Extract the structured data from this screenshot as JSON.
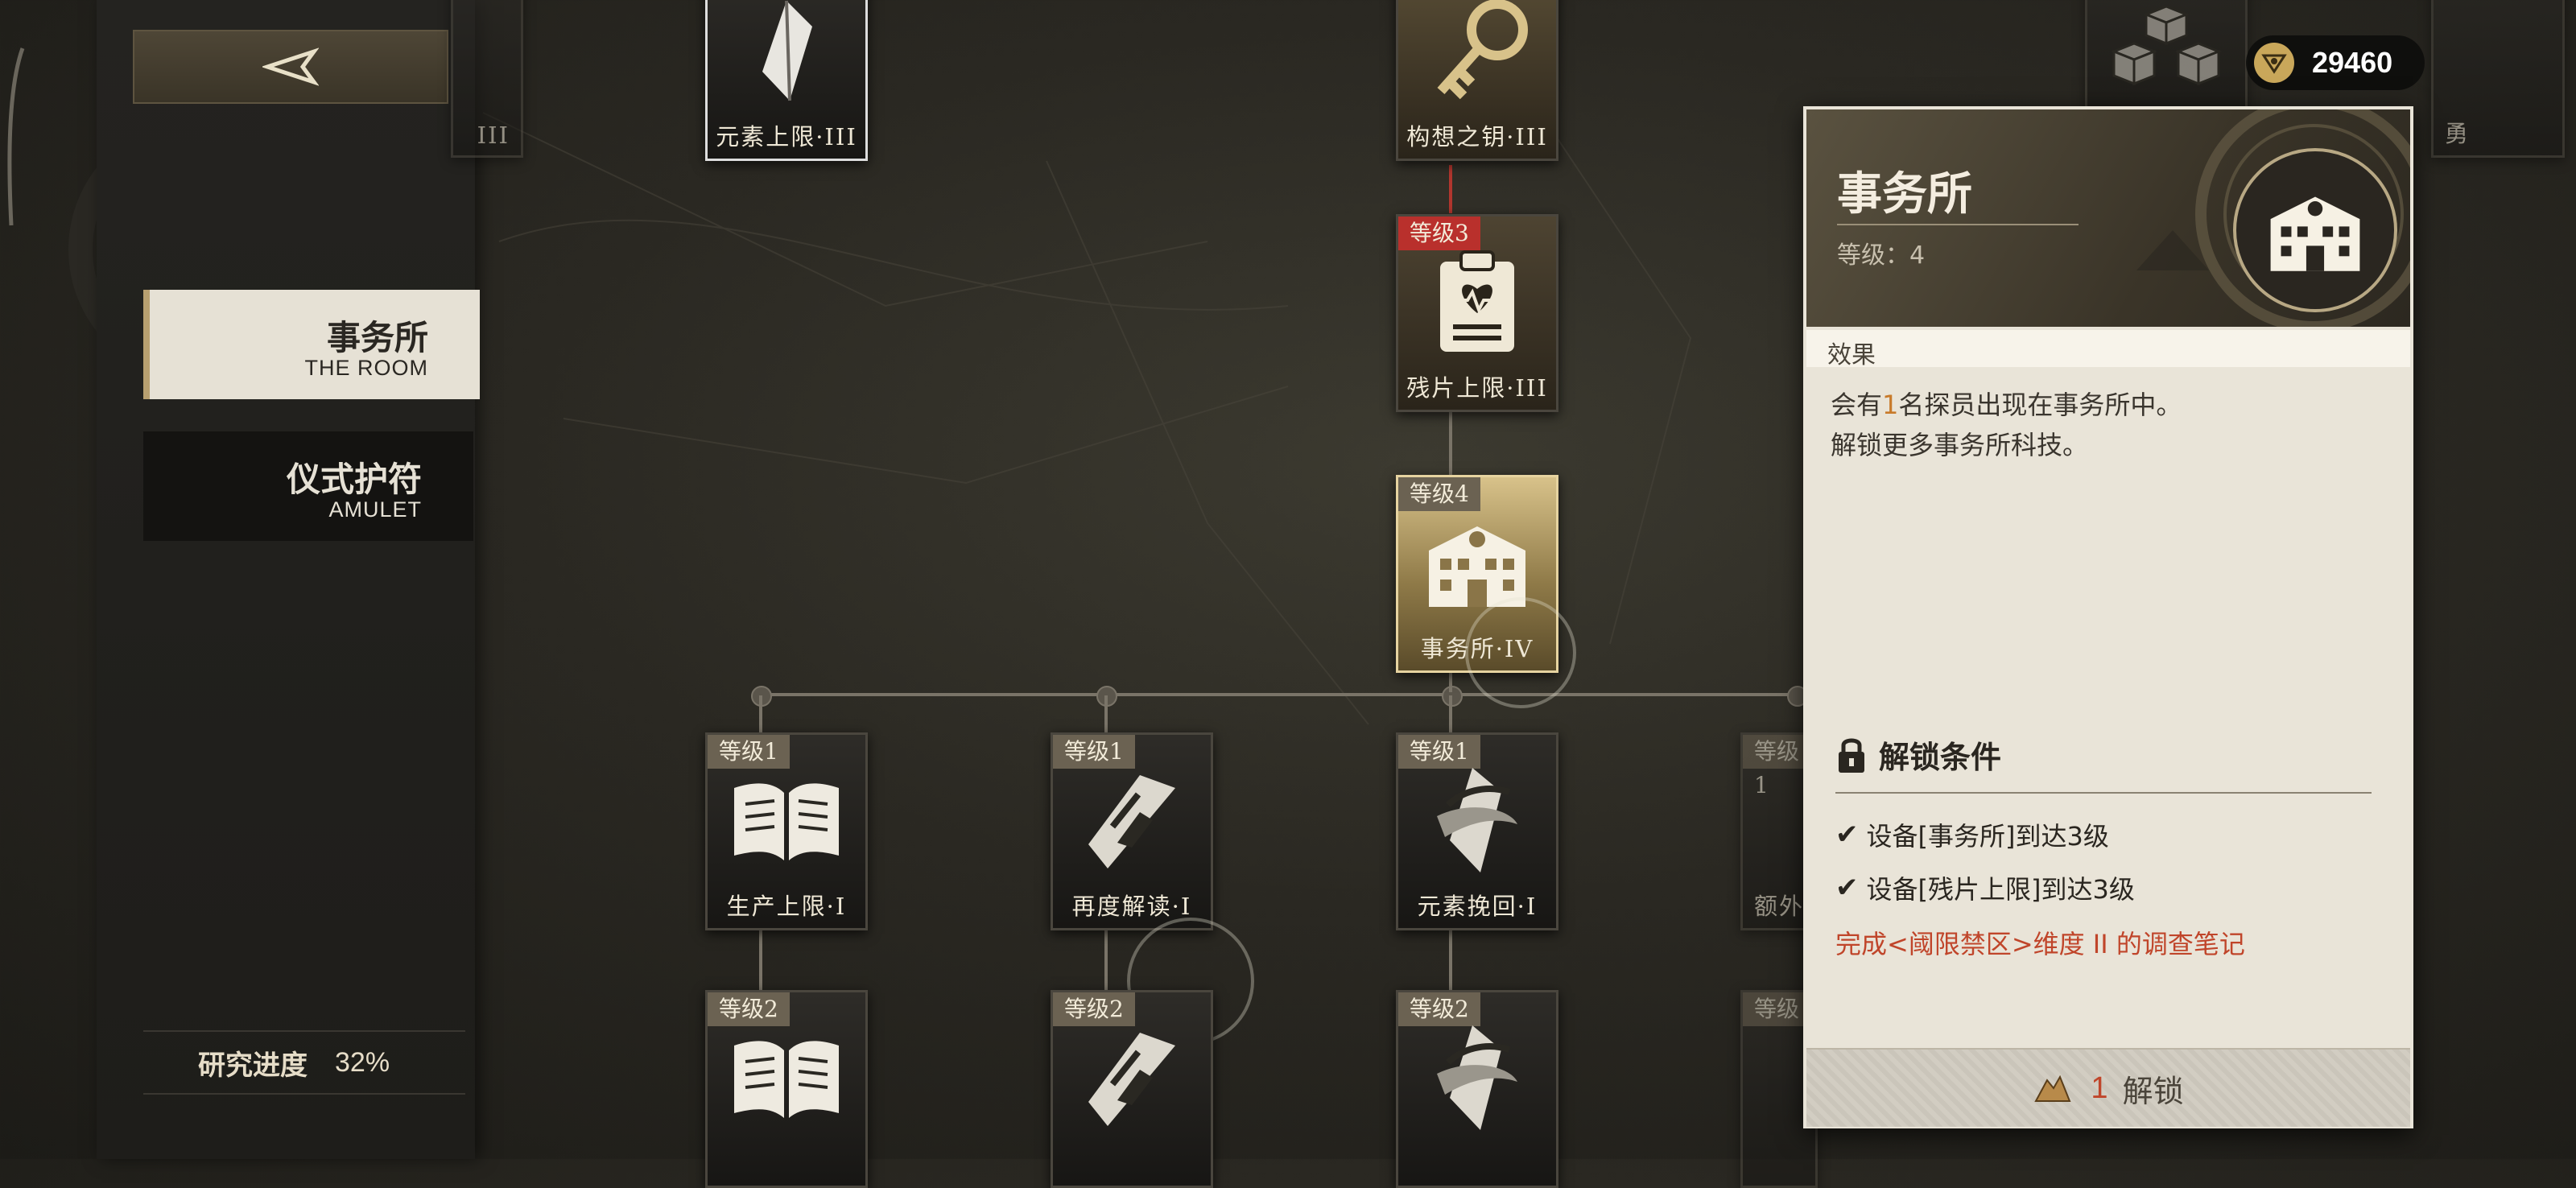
{
  "back_button": {
    "icon": "back-arrow-icon"
  },
  "sidebar": {
    "tabs": [
      {
        "zh": "事务所",
        "en": "THE ROOM",
        "active": true
      },
      {
        "zh": "仪式护符",
        "en": "AMULET",
        "active": false
      }
    ],
    "progress": {
      "label": "研究进度",
      "value": "32%"
    }
  },
  "currency": {
    "icon": "currency-coin-icon",
    "amount": "29460"
  },
  "nodes": {
    "left_partial": {
      "name": "III"
    },
    "element_cap": {
      "name": "元素上限·III",
      "icon": "crystal-icon"
    },
    "concept_key": {
      "name": "构想之钥·III",
      "icon": "key-icon"
    },
    "fragment_cap": {
      "badge": "等级3",
      "name": "残片上限·III",
      "icon": "clipboard-heart-icon"
    },
    "office": {
      "badge": "等级4",
      "name": "事务所·IV",
      "icon": "building-icon"
    },
    "right_partial_top": {
      "name": "勇"
    },
    "row1": [
      {
        "badge": "等级1",
        "name": "生产上限·I",
        "icon": "book-icon"
      },
      {
        "badge": "等级1",
        "name": "再度解读·I",
        "icon": "chain-link-icon"
      },
      {
        "badge": "等级1",
        "name": "元素挽回·I",
        "icon": "wrapped-crystal-icon"
      },
      {
        "badge": "等级1",
        "name": "额外",
        "icon": "partial-icon"
      }
    ],
    "row2": [
      {
        "badge": "等级2",
        "icon": "book-icon"
      },
      {
        "badge": "等级2",
        "icon": "chain-link-icon"
      },
      {
        "badge": "等级2",
        "icon": "wrapped-crystal-icon"
      },
      {
        "badge": "等级",
        "icon": "partial-icon"
      }
    ]
  },
  "panel": {
    "title": "事务所",
    "level": "等级：4",
    "effect_label": "效果",
    "effect_line1_a": "会有",
    "effect_line1_num": "1",
    "effect_line1_b": "名探员出现在事务所中。",
    "effect_line2": "解锁更多事务所科技。",
    "unlock_title": "解锁条件",
    "conditions": [
      {
        "text": "设备[事务所]到达3级",
        "met": true
      },
      {
        "text": "设备[残片上限]到达3级",
        "met": true
      },
      {
        "text": "完成<阈限禁区>维度 II 的调查笔记",
        "met": false
      }
    ],
    "unlock_button": {
      "cost": "1",
      "label": "解锁",
      "icon": "material-pile-icon"
    }
  },
  "colors": {
    "accent_gold": "#b8a070",
    "warning_red": "#c0452a",
    "highlight_orange": "#c87a2a"
  }
}
